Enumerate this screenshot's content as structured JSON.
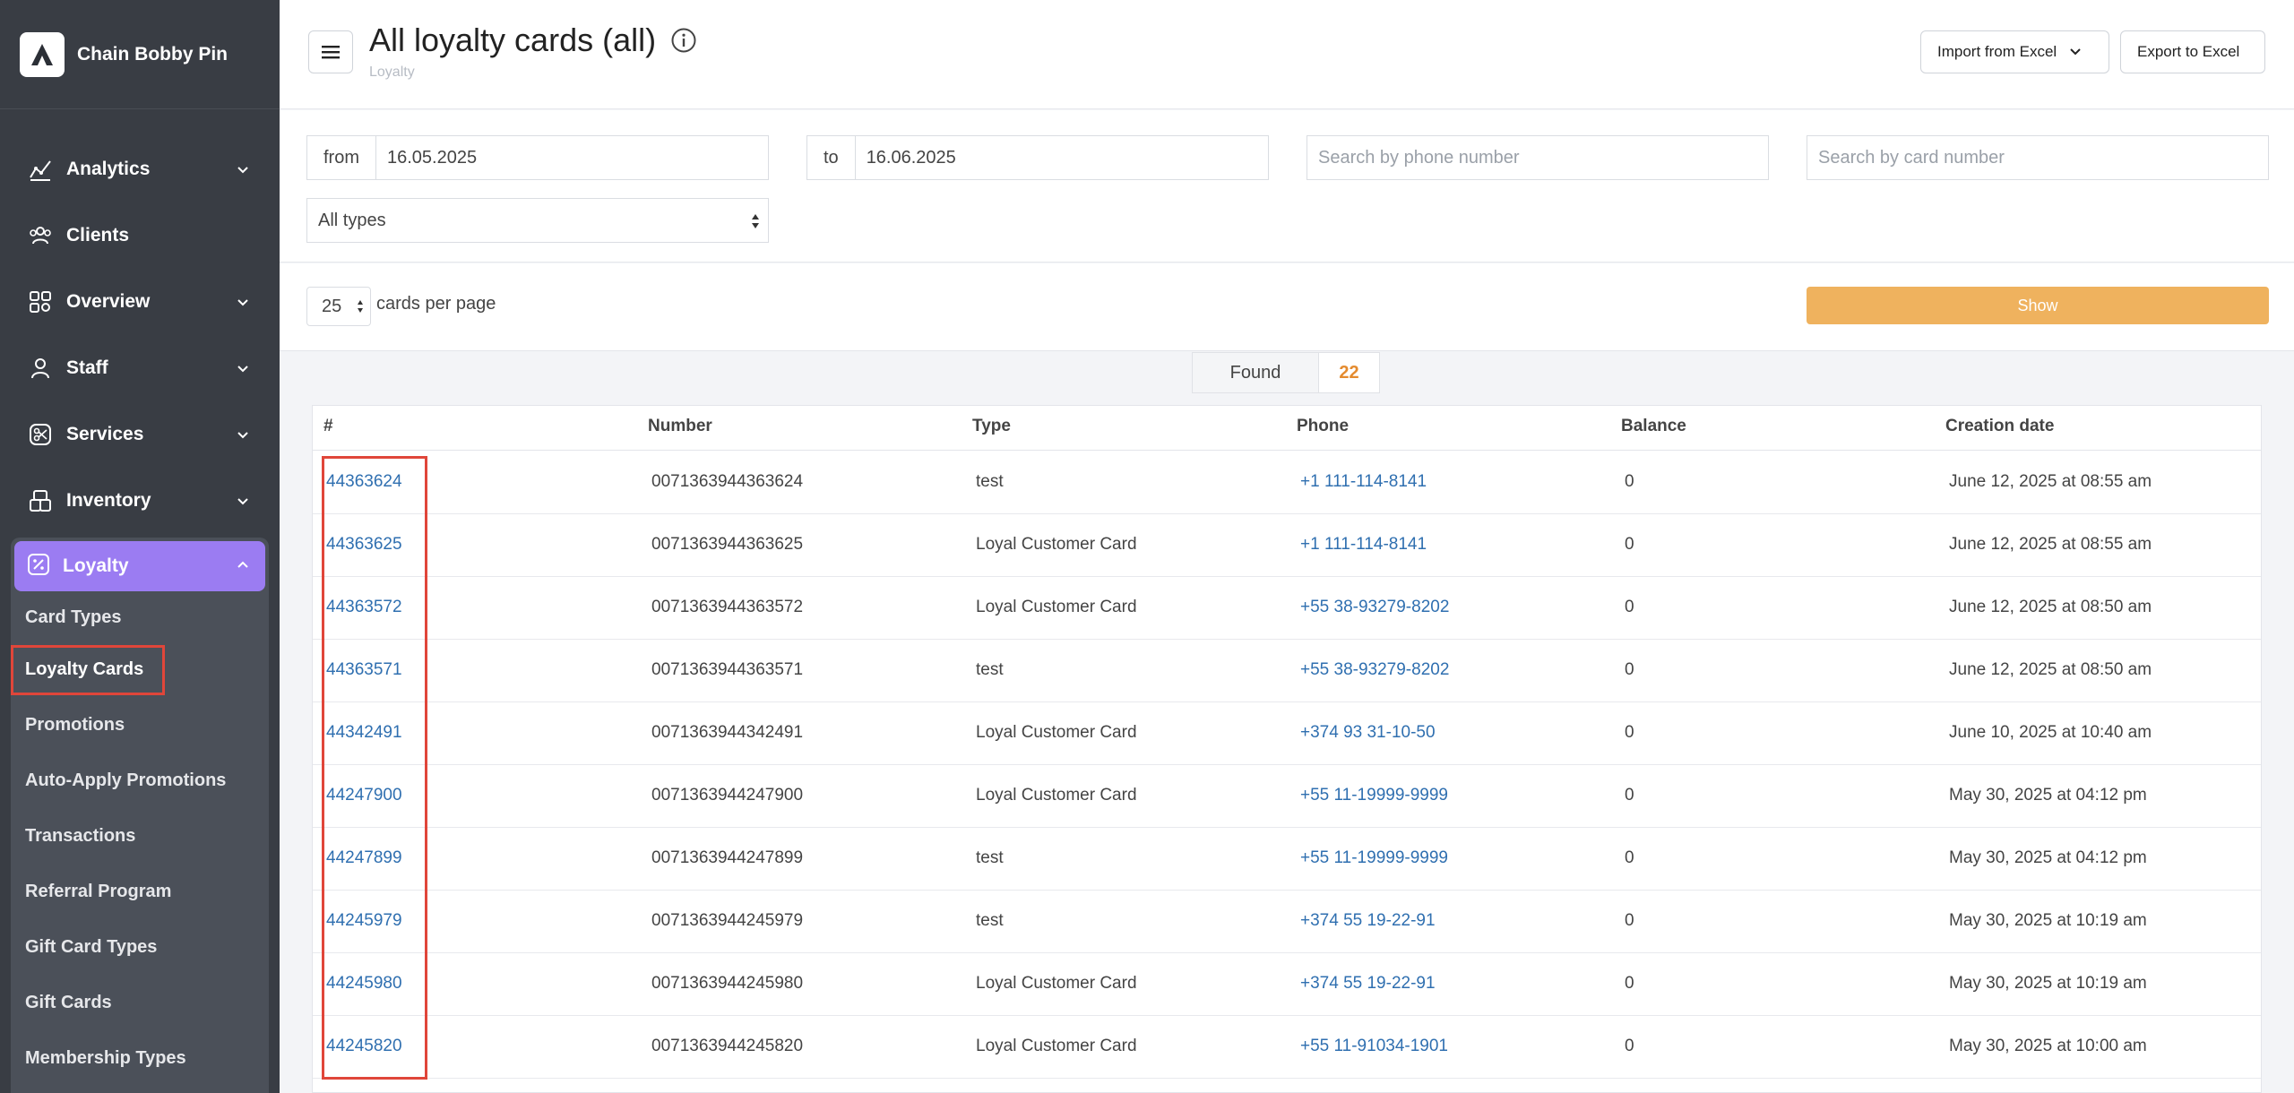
{
  "brand": {
    "name": "Chain Bobby Pin"
  },
  "sidebar": {
    "items": [
      {
        "label": "Analytics",
        "icon": "analytics-icon",
        "chevron": true
      },
      {
        "label": "Clients",
        "icon": "clients-icon",
        "chevron": false
      },
      {
        "label": "Overview",
        "icon": "overview-icon",
        "chevron": true
      },
      {
        "label": "Staff",
        "icon": "staff-icon",
        "chevron": true
      },
      {
        "label": "Services",
        "icon": "services-icon",
        "chevron": true
      },
      {
        "label": "Inventory",
        "icon": "inventory-icon",
        "chevron": true
      }
    ],
    "loyalty": {
      "label": "Loyalty",
      "sub": [
        "Card Types",
        "Loyalty Cards",
        "Promotions",
        "Auto-Apply Promotions",
        "Transactions",
        "Referral Program",
        "Gift Card Types",
        "Gift Cards",
        "Membership Types"
      ],
      "active": "Loyalty Cards"
    },
    "colors": {
      "bg": "#393d44",
      "active": "#9b7cf2"
    }
  },
  "header": {
    "title": "All loyalty cards (all)",
    "breadcrumb": "Loyalty",
    "import_label": "Import from Excel",
    "export_label": "Export to Excel"
  },
  "filters": {
    "from_label": "from",
    "from_value": "16.05.2025",
    "to_label": "to",
    "to_value": "16.06.2025",
    "phone_placeholder": "Search by phone number",
    "card_placeholder": "Search by card number",
    "type_value": "All types"
  },
  "pager": {
    "per_page": "25",
    "per_page_label": "cards per page",
    "show_label": "Show"
  },
  "found": {
    "label": "Found",
    "count": "22"
  },
  "table": {
    "columns": [
      "#",
      "Number",
      "Type",
      "Phone",
      "Balance",
      "Creation date"
    ],
    "rows": [
      {
        "id": "44363624",
        "number": "0071363944363624",
        "type": "test",
        "phone": "+1 111-114-8141",
        "balance": "0",
        "created": "June 12, 2025 at 08:55 am"
      },
      {
        "id": "44363625",
        "number": "0071363944363625",
        "type": "Loyal Customer Card",
        "phone": "+1 111-114-8141",
        "balance": "0",
        "created": "June 12, 2025 at 08:55 am"
      },
      {
        "id": "44363572",
        "number": "0071363944363572",
        "type": "Loyal Customer Card",
        "phone": "+55 38-93279-8202",
        "balance": "0",
        "created": "June 12, 2025 at 08:50 am"
      },
      {
        "id": "44363571",
        "number": "0071363944363571",
        "type": "test",
        "phone": "+55 38-93279-8202",
        "balance": "0",
        "created": "June 12, 2025 at 08:50 am"
      },
      {
        "id": "44342491",
        "number": "0071363944342491",
        "type": "Loyal Customer Card",
        "phone": "+374 93 31-10-50",
        "balance": "0",
        "created": "June 10, 2025 at 10:40 am"
      },
      {
        "id": "44247900",
        "number": "0071363944247900",
        "type": "Loyal Customer Card",
        "phone": "+55 11-19999-9999",
        "balance": "0",
        "created": "May 30, 2025 at 04:12 pm"
      },
      {
        "id": "44247899",
        "number": "0071363944247899",
        "type": "test",
        "phone": "+55 11-19999-9999",
        "balance": "0",
        "created": "May 30, 2025 at 04:12 pm"
      },
      {
        "id": "44245979",
        "number": "0071363944245979",
        "type": "test",
        "phone": "+374 55 19-22-91",
        "balance": "0",
        "created": "May 30, 2025 at 10:19 am"
      },
      {
        "id": "44245980",
        "number": "0071363944245980",
        "type": "Loyal Customer Card",
        "phone": "+374 55 19-22-91",
        "balance": "0",
        "created": "May 30, 2025 at 10:19 am"
      },
      {
        "id": "44245820",
        "number": "0071363944245820",
        "type": "Loyal Customer Card",
        "phone": "+55 11-91034-1901",
        "balance": "0",
        "created": "May 30, 2025 at 10:00 am"
      }
    ]
  },
  "colors": {
    "link": "#2f6fb0",
    "accent": "#efb25e",
    "highlight": "#e0463a",
    "found_count": "#e48b2f"
  }
}
